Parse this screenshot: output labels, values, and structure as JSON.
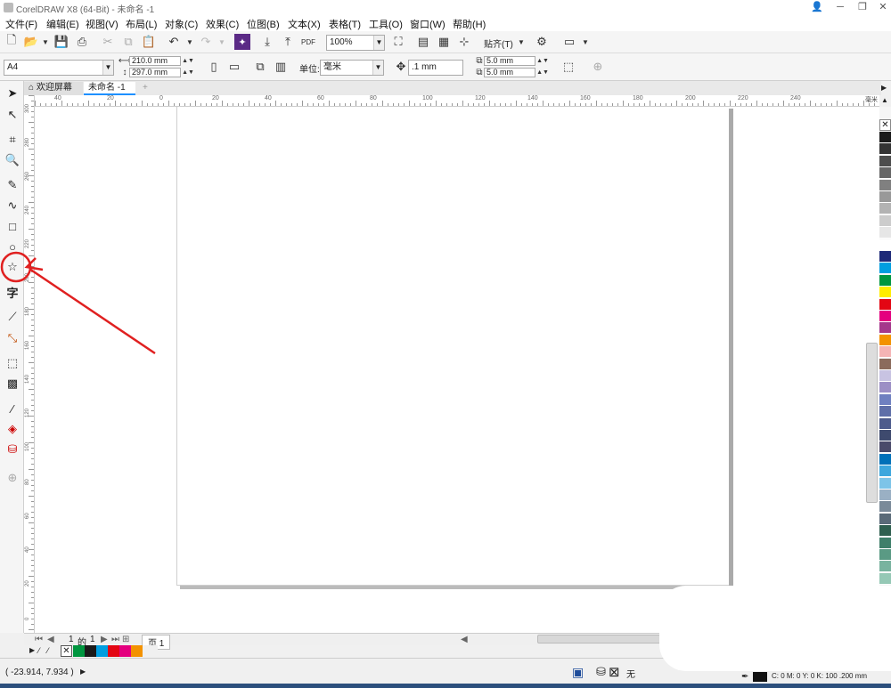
{
  "window": {
    "title": "CorelDRAW X8 (64-Bit) - 未命名 -1",
    "minimize_label": "─",
    "restore_label": "❐",
    "close_label": "✕"
  },
  "menu": [
    "文件(F)",
    "编辑(E)",
    "视图(V)",
    "布局(L)",
    "对象(C)",
    "效果(C)",
    "位图(B)",
    "文本(X)",
    "表格(T)",
    "工具(O)",
    "窗口(W)",
    "帮助(H)"
  ],
  "toolbar": {
    "zoom_value": "100%",
    "snap_label": "贴齐(T)",
    "pdf_label": "PDF"
  },
  "property_bar": {
    "page_size": "A4",
    "width": "210.0 mm",
    "height": "297.0 mm",
    "units_label": "单位:",
    "units_value": "毫米",
    "nudge": ".1 mm",
    "dup_x": "5.0 mm",
    "dup_y": "5.0 mm"
  },
  "doc_tabs": {
    "welcome": "欢迎屏幕",
    "document": "未命名 -1"
  },
  "ruler": {
    "h_ticks": [
      "40",
      "20",
      "0",
      "20",
      "40",
      "60",
      "80",
      "100",
      "120",
      "140",
      "160",
      "180",
      "200",
      "220",
      "240"
    ],
    "h_unit": "毫米",
    "v_ticks": [
      "300",
      "280",
      "260",
      "240",
      "220",
      "200",
      "180",
      "160",
      "140",
      "120",
      "100",
      "80",
      "60",
      "40",
      "20",
      "0"
    ]
  },
  "page_nav": {
    "current": "1",
    "of_label": "的",
    "total": "1",
    "page_tab": "页 1"
  },
  "status": {
    "coordinates": "( -23.914, 7.934 )",
    "fill_none_label": "无",
    "outline_info": "C: 0 M: 0 Y: 0 K: 100 .200 mm"
  },
  "palette_colors": [
    "#1a1a1a",
    "#333333",
    "#4d4d4d",
    "#666666",
    "#808080",
    "#999999",
    "#b3b3b3",
    "#cccccc",
    "#e6e6e6",
    "#ffffff",
    "#1e2a78",
    "#009ee0",
    "#00963f",
    "#ffed00",
    "#e30613",
    "#e4007f",
    "#a5378b",
    "#f39200",
    "#f5b4b5",
    "#8b6b5c",
    "#c8c3e2",
    "#9c8fc5",
    "#6f80c0",
    "#5f6fa8",
    "#4d5b8c",
    "#3e4a6e",
    "#4a4a6a",
    "#0070b8",
    "#3ea7dd",
    "#7dc4e8",
    "#9ab0c4",
    "#7a8a99",
    "#5a6a78",
    "#2f5f4f",
    "#3f7f6a",
    "#5a9a84",
    "#79b39f",
    "#95c8b5"
  ],
  "doc_palette_colors": [
    "#00963f",
    "#1a1a1a",
    "#009ee0",
    "#e30613",
    "#e4007f",
    "#f39200"
  ]
}
